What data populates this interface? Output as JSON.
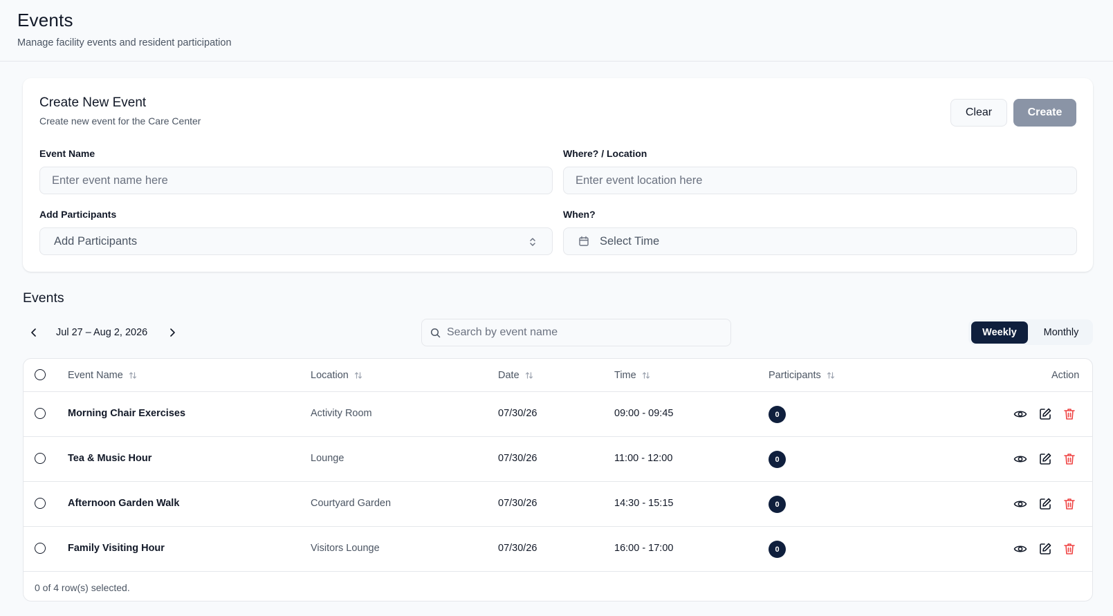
{
  "header": {
    "title": "Events",
    "subtitle": "Manage facility events and resident participation"
  },
  "create_form": {
    "title": "Create New Event",
    "subtitle": "Create new event for the Care Center",
    "clear_label": "Clear",
    "create_label": "Create",
    "event_name_label": "Event Name",
    "event_name_placeholder": "Enter event name here",
    "location_label": "Where? / Location",
    "location_placeholder": "Enter event location here",
    "participants_label": "Add Participants",
    "participants_placeholder": "Add Participants",
    "when_label": "When?",
    "when_placeholder": "Select Time"
  },
  "events": {
    "title": "Events",
    "date_range": "Jul 27 – Aug 2, 2026",
    "search_placeholder": "Search by event name",
    "view_toggle": {
      "weekly": "Weekly",
      "monthly": "Monthly",
      "selected": "Weekly"
    },
    "columns": {
      "name": "Event Name",
      "location": "Location",
      "date": "Date",
      "time": "Time",
      "participants": "Participants",
      "action": "Action"
    },
    "rows": [
      {
        "name": "Morning Chair Exercises",
        "location": "Activity Room",
        "date": "07/30/26",
        "time": "09:00 - 09:45",
        "participants": "0"
      },
      {
        "name": "Tea & Music Hour",
        "location": "Lounge",
        "date": "07/30/26",
        "time": "11:00 - 12:00",
        "participants": "0"
      },
      {
        "name": "Afternoon Garden Walk",
        "location": "Courtyard Garden",
        "date": "07/30/26",
        "time": "14:30 - 15:15",
        "participants": "0"
      },
      {
        "name": "Family Visiting Hour",
        "location": "Visitors Lounge",
        "date": "07/30/26",
        "time": "16:00 - 17:00",
        "participants": "0"
      }
    ],
    "footer": "0 of 4 row(s) selected."
  },
  "colors": {
    "primary": "#0f1f3d",
    "create_button_disabled": "#8a94a6",
    "delete": "#ef4444",
    "background": "#f8fafc"
  },
  "icons": {
    "prev": "chevron-left-icon",
    "next": "chevron-right-icon",
    "search": "search-icon",
    "calendar": "calendar-icon",
    "select": "chevrons-up-down-icon",
    "sort": "sort-icon",
    "view": "eye-icon",
    "edit": "edit-icon",
    "delete": "trash-icon"
  }
}
